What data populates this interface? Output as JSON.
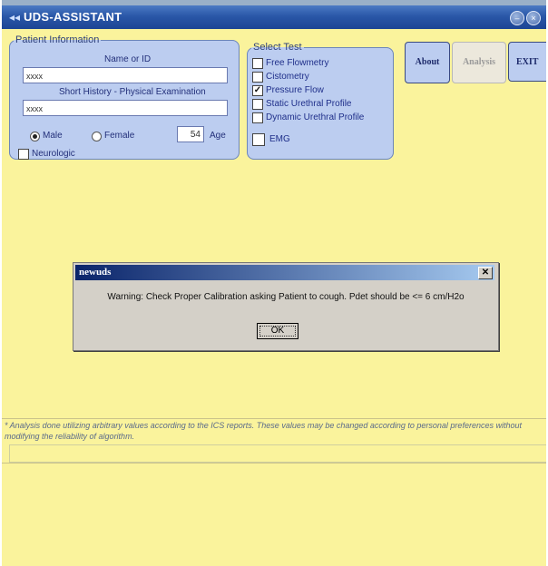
{
  "window": {
    "title": "UDS-ASSISTANT"
  },
  "patient_info": {
    "legend": "Patient Information",
    "name_label": "Name or ID",
    "name_value": "xxxx",
    "history_label": "Short History - Physical Examination",
    "history_value": "xxxx",
    "gender_options": [
      "Male",
      "Female"
    ],
    "gender_selected": "Male",
    "age_value": "54",
    "age_label": "Age",
    "neurologic_label": "Neurologic",
    "neurologic_checked": false
  },
  "select_test": {
    "legend": "Select Test",
    "items": [
      {
        "label": "Free Flowmetry",
        "checked": false
      },
      {
        "label": "Cistometry",
        "checked": false
      },
      {
        "label": "Pressure Flow",
        "checked": true
      },
      {
        "label": "Static Urethral Profile",
        "checked": false
      },
      {
        "label": "Dynamic Urethral Profile",
        "checked": false
      }
    ],
    "emg_label": "EMG",
    "emg_checked": false
  },
  "side_buttons": {
    "about": "About",
    "analysis": "Analysis",
    "exit": "EXIT"
  },
  "dialog": {
    "title": "newuds",
    "message": "Warning: Check Proper Calibration asking Patient to cough. Pdet should be <= 6 cm/H2o",
    "ok_label": "OK"
  },
  "footnote": {
    "text": "* Analysis done  utilizing arbitrary values according to the ICS reports. These values may be changed according to personal preferences without modifying the reliability of algorithm."
  },
  "colors": {
    "background": "#faf39c",
    "titlebar": "#2a57a8",
    "group_fill": "#bccdf0",
    "dialog_face": "#d4d0c8"
  }
}
